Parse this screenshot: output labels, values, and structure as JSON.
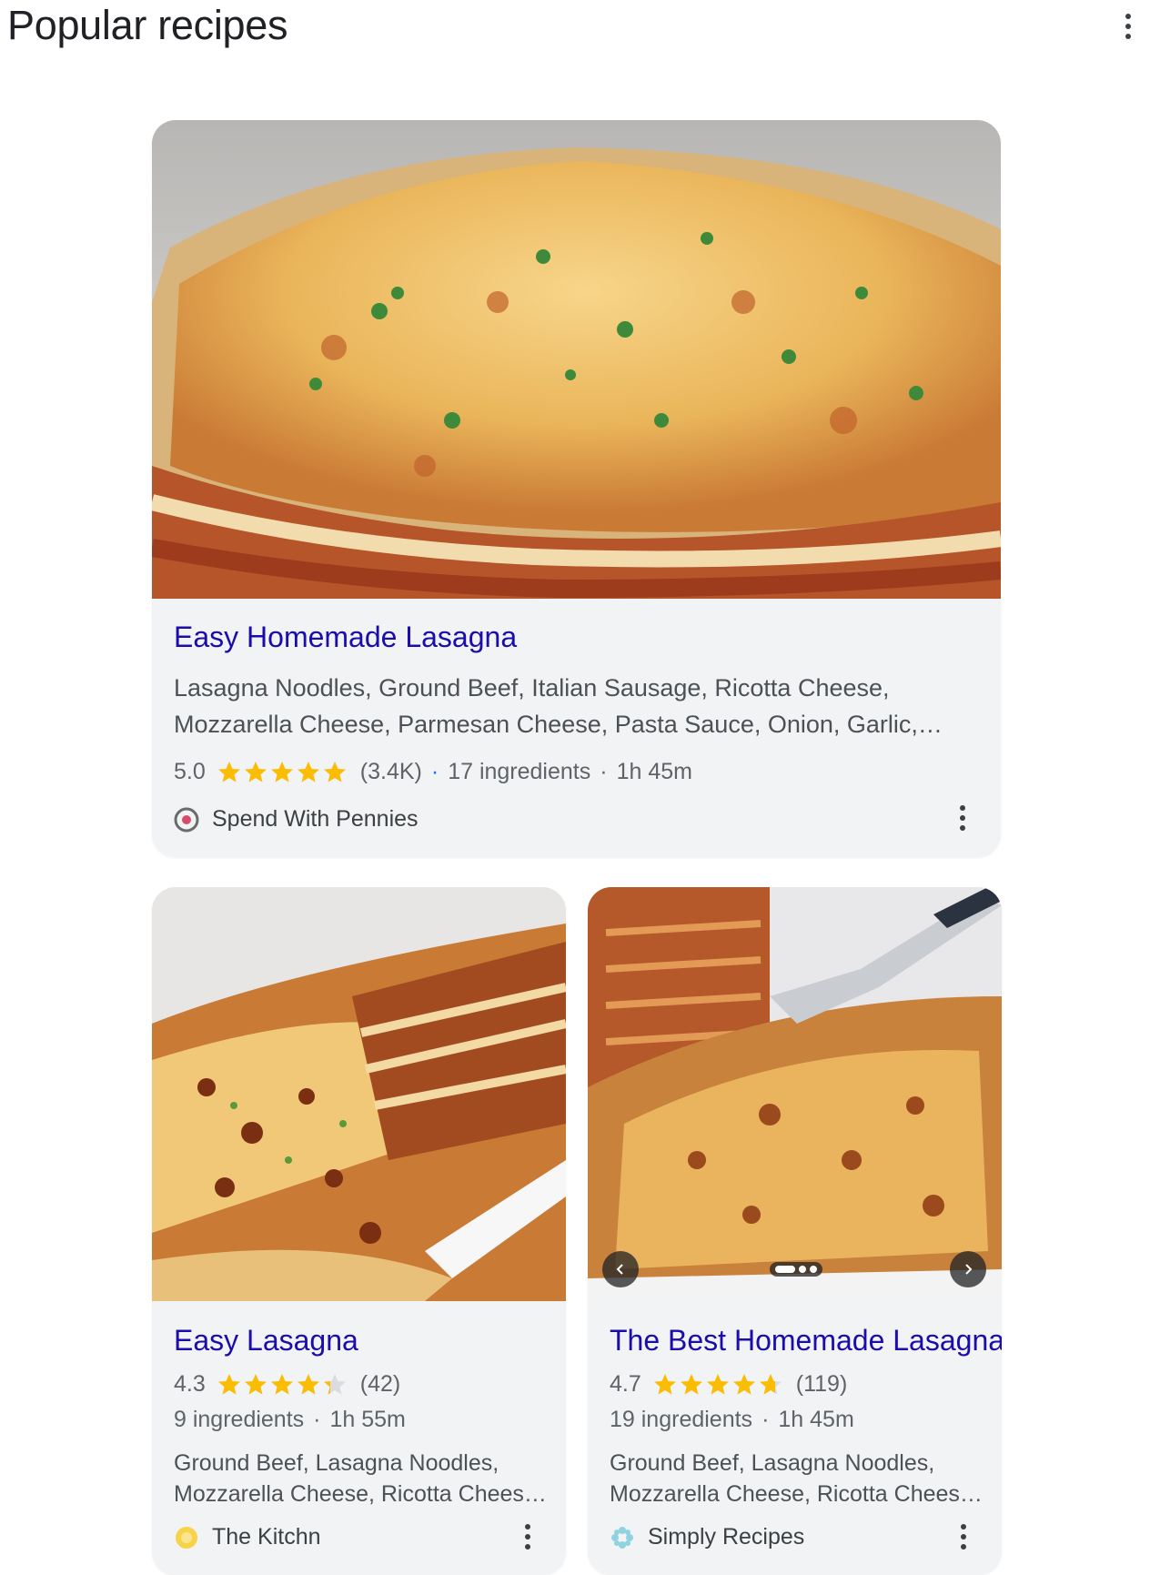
{
  "header": {
    "title": "Popular recipes"
  },
  "colors": {
    "link": "#1a0dab",
    "star": "#fbbc04",
    "card_bg": "#f1f3f4",
    "text": "#4d5156"
  },
  "recipes": [
    {
      "title": "Easy Homemade Lasagna",
      "ingredients_text": "Lasagna Noodles, Ground Beef, Italian Sausage, Ricotta Cheese, Mozzarella Cheese, Parmesan Cheese, Pasta Sauce, Onion, Garlic,…",
      "rating": "5.0",
      "rating_value": 5.0,
      "reviews": "(3.4K)",
      "ingredients_count": "17 ingredients",
      "time": "1h 45m",
      "source": "Spend With Pennies",
      "source_icon": "spend-with-pennies-logo",
      "image_alt": "lasagna-slice-photo"
    },
    {
      "title": "Easy Lasagna",
      "rating": "4.3",
      "rating_value": 4.3,
      "reviews": "(42)",
      "ingredients_count": "9 ingredients",
      "time": "1h 55m",
      "ingredients_text": "Ground Beef, Lasagna Noodles, Mozzarella Cheese, Ricotta Chees…",
      "source": "The Kitchn",
      "source_icon": "the-kitchn-logo",
      "image_alt": "lasagna-in-dish-photo"
    },
    {
      "title": "The Best Homemade Lasagna",
      "rating": "4.7",
      "rating_value": 4.7,
      "reviews": "(119)",
      "ingredients_count": "19 ingredients",
      "time": "1h 45m",
      "ingredients_text": "Ground Beef, Lasagna Noodles, Mozzarella Cheese, Ricotta Chees…",
      "source": "Simply Recipes",
      "source_icon": "simply-recipes-logo",
      "image_alt": "lasagna-serving-photo",
      "carousel": {
        "slides": 3,
        "active": 1
      }
    }
  ]
}
